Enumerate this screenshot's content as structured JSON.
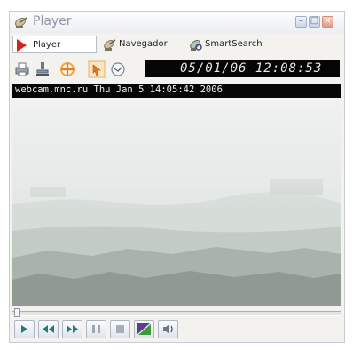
{
  "window": {
    "title": "Player"
  },
  "tabs": [
    {
      "label": "Player",
      "icon": "play-triangle-icon"
    },
    {
      "label": "Navegador",
      "icon": "satellite-dish-icon"
    },
    {
      "label": "SmartSearch",
      "icon": "search-dish-icon"
    }
  ],
  "toolbar": {
    "clock": "05/01/06 12:08:53",
    "icons": [
      "print-icon",
      "stamp-icon",
      "orange-cross-icon",
      "pointer-icon",
      "clock-icon"
    ]
  },
  "video": {
    "overlay_text": "webcam.mnc.ru  Thu Jan 5 14:05:42 2006"
  },
  "playback": {
    "position": 0.0,
    "controls": [
      "play-icon",
      "rewind-icon",
      "fast-forward-icon",
      "pause-icon",
      "stop-icon",
      "snapshot-icon",
      "volume-icon"
    ]
  },
  "colors": {
    "accent": "#d2231e",
    "clock_bg": "#050505"
  }
}
